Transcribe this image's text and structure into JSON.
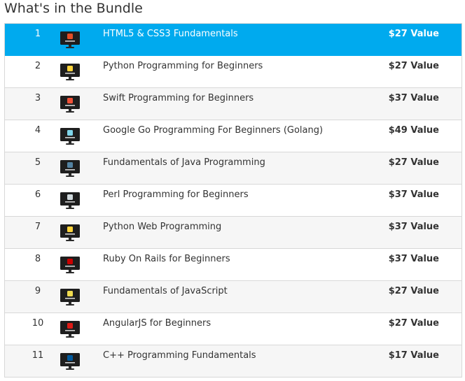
{
  "heading": "What's in the Bundle",
  "colors": {
    "selected_row": "#00aaee",
    "alt_row": "#f6f6f6",
    "border": "#d8d8d8",
    "text": "#333333"
  },
  "items": [
    {
      "num": "1",
      "title": "HTML5 & CSS3 Fundamentals",
      "price": "$27 Value",
      "icon": "html5-css3-icon",
      "badge_color": "#e44d26",
      "selected": true
    },
    {
      "num": "2",
      "title": "Python Programming for Beginners",
      "price": "$27 Value",
      "icon": "python-icon",
      "badge_color": "#ffd43b"
    },
    {
      "num": "3",
      "title": "Swift Programming for Beginners",
      "price": "$37 Value",
      "icon": "swift-icon",
      "badge_color": "#f05138"
    },
    {
      "num": "4",
      "title": "Google Go Programming For Beginners (Golang)",
      "price": "$49 Value",
      "icon": "golang-icon",
      "badge_color": "#7fd5ea"
    },
    {
      "num": "5",
      "title": "Fundamentals of Java Programming",
      "price": "$27 Value",
      "icon": "java-icon",
      "badge_color": "#5382a1"
    },
    {
      "num": "6",
      "title": "Perl Programming for Beginners",
      "price": "$37 Value",
      "icon": "perl-icon",
      "badge_color": "#cfd8dc"
    },
    {
      "num": "7",
      "title": "Python Web Programming",
      "price": "$37 Value",
      "icon": "python-web-icon",
      "badge_color": "#ffd43b"
    },
    {
      "num": "8",
      "title": "Ruby On Rails for Beginners",
      "price": "$37 Value",
      "icon": "ruby-on-rails-icon",
      "badge_color": "#cc0000"
    },
    {
      "num": "9",
      "title": "Fundamentals of JavaScript",
      "price": "$27 Value",
      "icon": "javascript-icon",
      "badge_color": "#f0db4f"
    },
    {
      "num": "10",
      "title": "AngularJS for Beginners",
      "price": "$27 Value",
      "icon": "angularjs-icon",
      "badge_color": "#dd1b16"
    },
    {
      "num": "11",
      "title": "C++ Programming Fundamentals",
      "price": "$17 Value",
      "icon": "cpp-icon",
      "badge_color": "#00599c"
    }
  ]
}
